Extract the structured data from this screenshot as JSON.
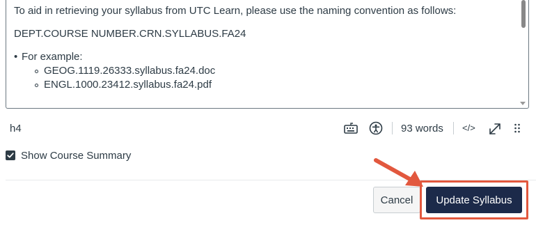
{
  "editor": {
    "paragraph1": "To aid in retrieving your syllabus from UTC Learn, please use the naming convention as follows:",
    "paragraph2": "DEPT.COURSE NUMBER.CRN.SYLLABUS.FA24",
    "bullet_label": "For example:",
    "examples": [
      "GEOG.1119.26333.syllabus.fa24.doc",
      "ENGL.1000.23412.syllabus.fa24.pdf"
    ]
  },
  "status_bar": {
    "element_path": "h4",
    "word_count": "93 words",
    "html_toggle": "</>",
    "icons": [
      "keyboard-icon",
      "accessibility-icon",
      "expand-icon",
      "resize-grip-icon"
    ]
  },
  "show_course_summary": {
    "label": "Show Course Summary",
    "checked": true
  },
  "actions": {
    "cancel_label": "Cancel",
    "update_label": "Update Syllabus"
  },
  "colors": {
    "primary_button": "#1c2a4a",
    "annotation": "#e2583e",
    "text": "#2d3b45"
  }
}
